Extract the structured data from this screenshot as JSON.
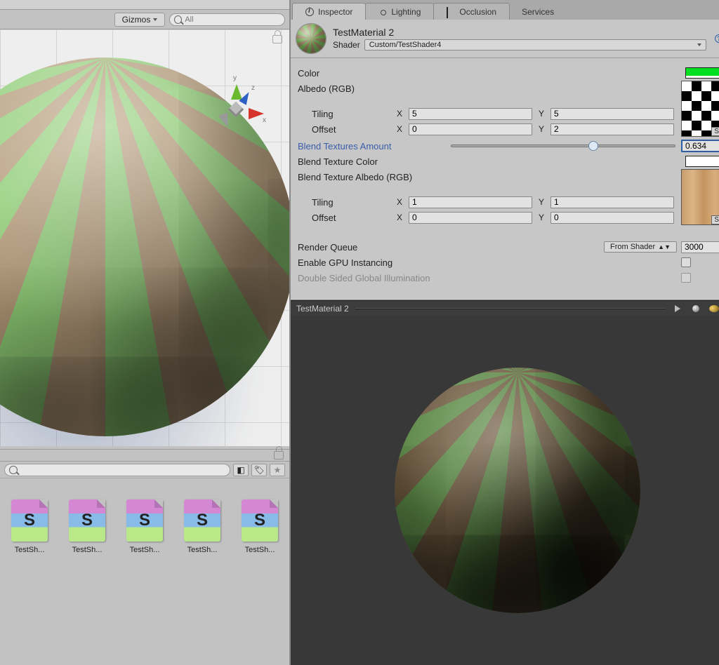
{
  "scene_toolbar": {
    "gizmos_label": "Gizmos",
    "search_placeholder": "All"
  },
  "axis": {
    "x": "x",
    "y": "y",
    "z": "z"
  },
  "inspector_tabs": {
    "inspector": "Inspector",
    "lighting": "Lighting",
    "occlusion": "Occlusion",
    "services": "Services"
  },
  "material": {
    "name": "TestMaterial 2",
    "shader_label": "Shader",
    "shader_value": "Custom/TestShader4"
  },
  "props": {
    "color_label": "Color",
    "color_value": "#00e020",
    "albedo_label": "Albedo (RGB)",
    "tiling_label": "Tiling",
    "offset_label": "Offset",
    "albedo_tiling": {
      "x": "5",
      "y": "5"
    },
    "albedo_offset": {
      "x": "0",
      "y": "2"
    },
    "select_label": "Select",
    "blend_amount_label": "Blend Textures Amount",
    "blend_amount_value": "0.634",
    "blend_amount_pct": 63.4,
    "blend_color_label": "Blend Texture Color",
    "blend_color_value": "#ffffff",
    "blend_albedo_label": "Blend Texture Albedo (RGB)",
    "blend_tiling": {
      "x": "1",
      "y": "1"
    },
    "blend_offset": {
      "x": "0",
      "y": "0"
    },
    "render_queue_label": "Render Queue",
    "render_queue_mode": "From Shader",
    "render_queue_value": "3000",
    "gpu_instancing_label": "Enable GPU Instancing",
    "dsgi_label": "Double Sided Global Illumination",
    "x_char": "X",
    "y_char": "Y"
  },
  "preview": {
    "title": "TestMaterial 2"
  },
  "assets": {
    "glyph": "S",
    "items": [
      {
        "label": "TestSh..."
      },
      {
        "label": "TestSh..."
      },
      {
        "label": "TestSh..."
      },
      {
        "label": "TestSh..."
      },
      {
        "label": "TestSh..."
      }
    ]
  }
}
